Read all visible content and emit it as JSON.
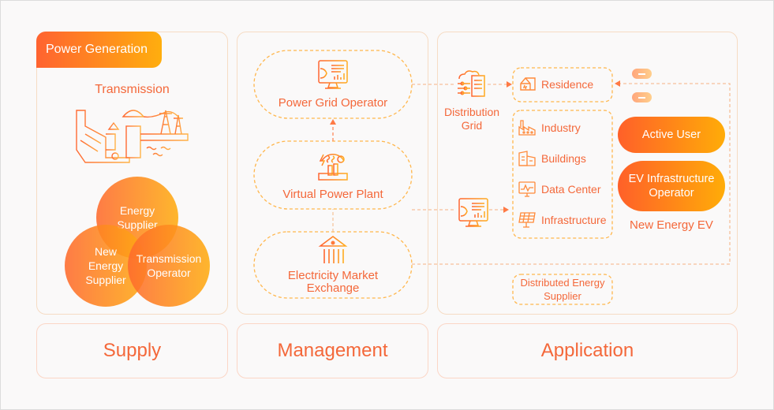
{
  "supply": {
    "tab_label": "Power Generation",
    "subtitle": "Transmission",
    "circles": [
      {
        "label": "Energy Supplier"
      },
      {
        "label": "New Energy Supplier"
      },
      {
        "label": "Transmission Operator"
      }
    ]
  },
  "management": {
    "nodes": [
      {
        "label": "Power Grid Operator",
        "icon": "monitor-dashboard-icon"
      },
      {
        "label": "Virtual Power Plant",
        "icon": "power-plant-icon"
      },
      {
        "label": "Electricity Market Exchange",
        "icon": "bank-building-icon"
      }
    ]
  },
  "application": {
    "distribution_grid": "Distribution Grid",
    "residence": "Residence",
    "consumers": [
      {
        "label": "Industry",
        "icon": "factory-icon"
      },
      {
        "label": "Buildings",
        "icon": "buildings-icon"
      },
      {
        "label": "Data Center",
        "icon": "data-center-icon"
      },
      {
        "label": "Infrastructure",
        "icon": "solar-panel-icon"
      }
    ],
    "active_user": "Active User",
    "ev_operator": "EV Infrastructure Operator",
    "new_energy_ev": "New Energy EV",
    "distributed_supplier": "Distributed Energy Supplier"
  },
  "categories": {
    "supply": "Supply",
    "management": "Management",
    "application": "Application"
  },
  "colors": {
    "accent_start": "#ff6330",
    "accent_end": "#ffae0e",
    "text_orange": "#f4683a",
    "panel_border": "#f6dcc4"
  }
}
